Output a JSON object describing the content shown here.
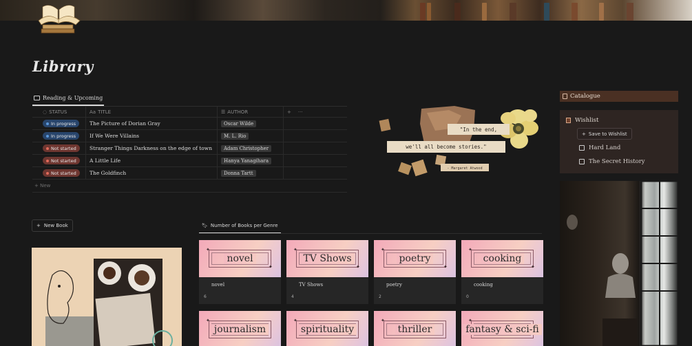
{
  "page": {
    "title": "Library"
  },
  "reading_db": {
    "tab_label": "Reading & Upcoming",
    "columns": {
      "status": "STATUS",
      "title": "TITLE",
      "author": "AUTHOR",
      "add": "+",
      "more": "···",
      "title_prefix": "Aa"
    },
    "rows": [
      {
        "status": "In progress",
        "title": "The Picture of Dorian Gray",
        "author": "Oscar Wilde"
      },
      {
        "status": "In progress",
        "title": "If We Were Villains",
        "author": "M. L. Rio"
      },
      {
        "status": "Not started",
        "title": "Stranger Things Darkness on the edge of town",
        "author": "Adam Christopher"
      },
      {
        "status": "Not started",
        "title": "A Little Life",
        "author": "Hanya Yanagihara"
      },
      {
        "status": "Not started",
        "title": "The Goldfinch",
        "author": "Donna Tartt"
      }
    ],
    "new_label": "+ New"
  },
  "quote": {
    "line1": "\"In the end,",
    "line2": "we'll all become stories.\"",
    "attribution": "- Margaret Atwood"
  },
  "sidebar": {
    "catalogue_label": "Catalogue",
    "wishlist_title": "Wishlist",
    "save_button": "Save to Wishlist",
    "items": [
      "Hard Land",
      "The Secret History"
    ]
  },
  "new_book_button": "New Book",
  "genres": {
    "tab_label": "Number of Books per Genre",
    "cards": [
      {
        "name": "novel",
        "count": "6"
      },
      {
        "name": "TV Shows",
        "count": "4"
      },
      {
        "name": "poetry",
        "count": "2"
      },
      {
        "name": "cooking",
        "count": "0"
      },
      {
        "name": "journalism"
      },
      {
        "name": "spirituality"
      },
      {
        "name": "thriller"
      },
      {
        "name": "fantasy & sci-fi"
      }
    ]
  },
  "colors": {
    "in_progress_bg": "#28456c",
    "in_progress_dot": "#5b97d9",
    "not_started_bg": "#6e3630",
    "not_started_dot": "#e06a5a",
    "catalogue_bg": "#4a3023"
  },
  "icons": {
    "banner_book": "open-book-stack-icon",
    "tab": "book-icon",
    "gallery": "bookmark-icon",
    "plus": "plus-icon"
  }
}
